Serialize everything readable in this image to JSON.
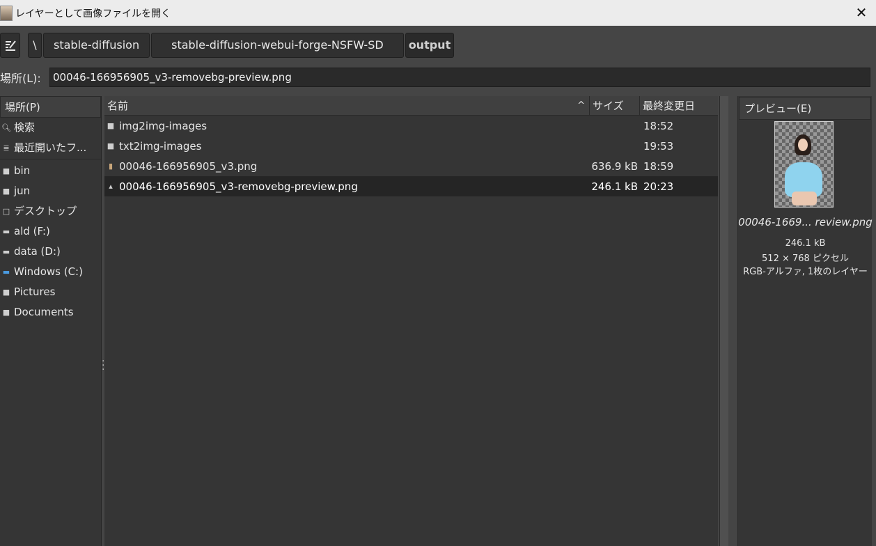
{
  "window": {
    "title": "レイヤーとして画像ファイルを開く",
    "close_label": "✕"
  },
  "pathbar": {
    "separator": "\\",
    "crumbs": [
      "stable-diffusion",
      "stable-diffusion-webui-forge-NSFW-SD",
      "output"
    ]
  },
  "location": {
    "label": "場所(L):",
    "value": "00046-166956905_v3-removebg-preview.png"
  },
  "places": {
    "header": "場所(P)",
    "items": [
      {
        "label": "検索",
        "icon": "search-icon"
      },
      {
        "label": "最近開いたフ...",
        "icon": "recent-icon"
      },
      {
        "label": "bin",
        "icon": "folder-icon"
      },
      {
        "label": "jun",
        "icon": "folder-icon"
      },
      {
        "label": "デスクトップ",
        "icon": "desktop-folder-icon"
      },
      {
        "label": "ald (F:)",
        "icon": "drive-icon"
      },
      {
        "label": "data (D:)",
        "icon": "drive-icon"
      },
      {
        "label": "Windows (C:)",
        "icon": "windows-drive-icon"
      },
      {
        "label": "Pictures",
        "icon": "folder-icon"
      },
      {
        "label": "Documents",
        "icon": "folder-icon"
      }
    ]
  },
  "files": {
    "columns": {
      "name": "名前",
      "size": "サイズ",
      "modified": "最終変更日"
    },
    "rows": [
      {
        "name": "img2img-images",
        "size": "",
        "modified": "18:52",
        "icon": "folder-icon"
      },
      {
        "name": "txt2img-images",
        "size": "",
        "modified": "19:53",
        "icon": "folder-icon"
      },
      {
        "name": "00046-166956905_v3.png",
        "size": "636.9 kB",
        "modified": "18:59",
        "icon": "image-file-icon"
      },
      {
        "name": "00046-166956905_v3-removebg-preview.png",
        "size": "246.1 kB",
        "modified": "20:23",
        "icon": "image-file-icon"
      }
    ]
  },
  "preview": {
    "header": "プレビュー(E)",
    "filename": "00046-1669... review.png",
    "size": "246.1 kB",
    "dimensions": "512 × 768 ピクセル",
    "details": "RGB-アルファ, 1枚のレイヤー"
  },
  "colors": {
    "background": "#454545",
    "panel": "#353535",
    "selected_row": "#252525",
    "titlebar": "#ececec"
  }
}
